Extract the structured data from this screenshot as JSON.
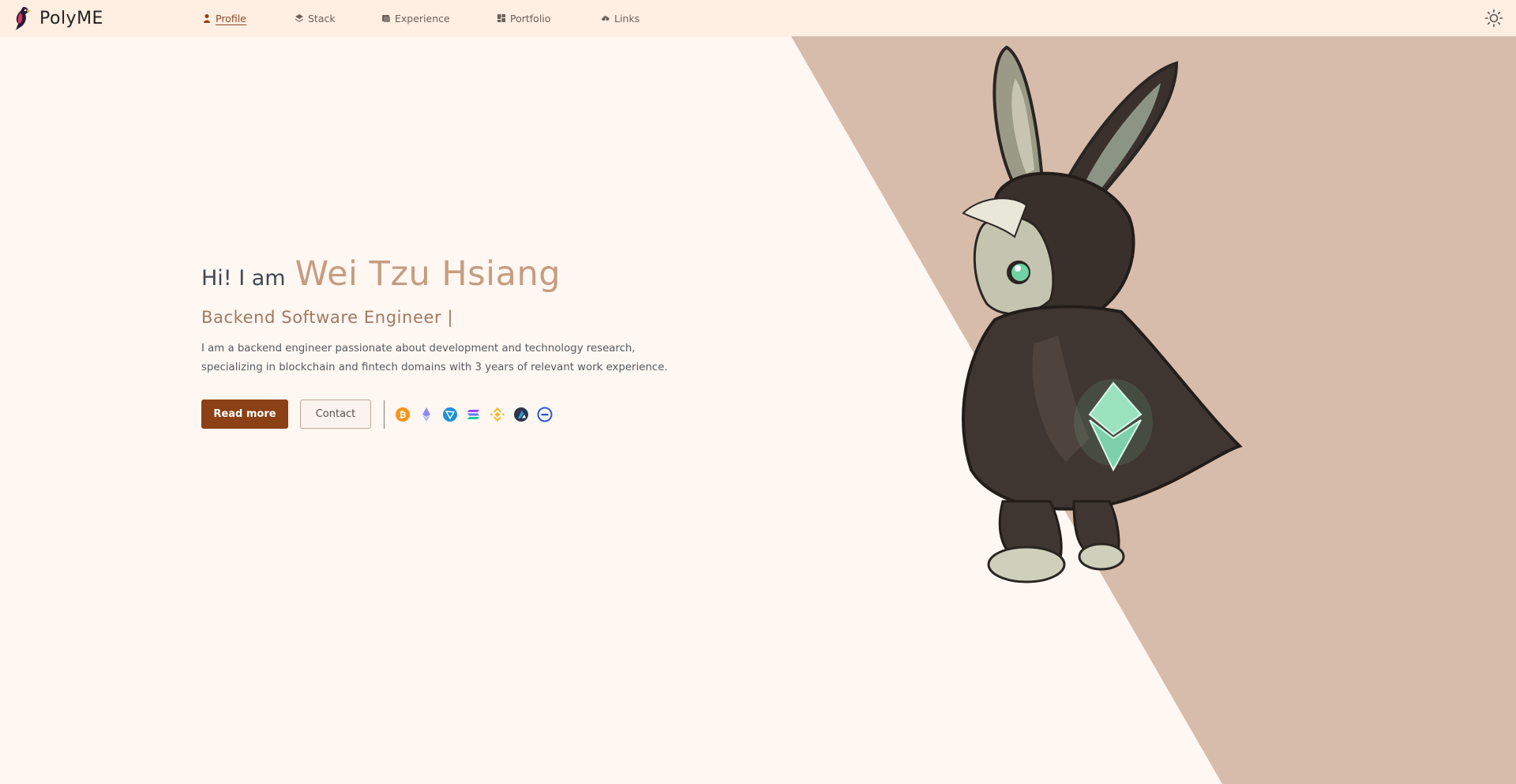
{
  "app": {
    "logo_text": "PolyME"
  },
  "nav": [
    {
      "label": "Profile",
      "icon": "person-icon",
      "active": true
    },
    {
      "label": "Stack",
      "icon": "layers-icon"
    },
    {
      "label": "Experience",
      "icon": "scroll-icon"
    },
    {
      "label": "Portfolio",
      "icon": "grid-icon"
    },
    {
      "label": "Links",
      "icon": "link-cloud-icon"
    }
  ],
  "hero": {
    "greeting": "Hi! I am",
    "name": "Wei Tzu Hsiang",
    "role": "Backend Software Engineer |",
    "description": "I am a backend engineer passionate about development and technology research, specializing in blockchain and fintech domains with 3 years of relevant work experience.",
    "read_more": "Read more",
    "contact": "Contact"
  },
  "chains": [
    "bitcoin-icon",
    "ethereum-icon",
    "tron-icon",
    "solana-icon",
    "bnb-icon",
    "arbitrum-icon",
    "chainlink-icon"
  ],
  "colors": {
    "nav_bg": "#ffeee2",
    "page_bg": "#fff7f2",
    "diagonal_bg": "#d7bcab",
    "accent": "#8b4015",
    "name_color": "#c69c7f"
  }
}
